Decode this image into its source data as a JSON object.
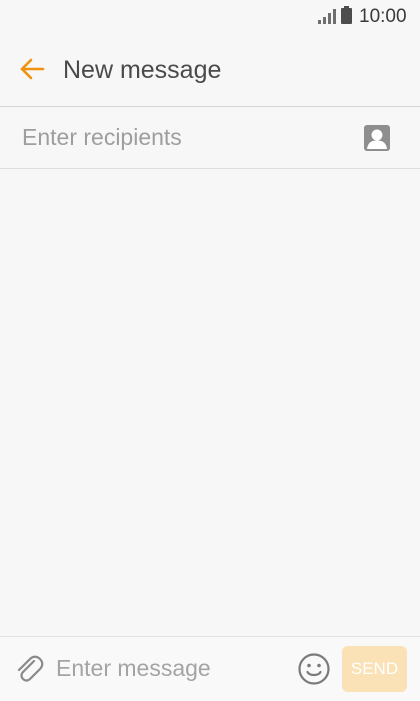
{
  "status_bar": {
    "time": "10:00",
    "signal_icon": "signal-icon",
    "battery_icon": "battery-icon"
  },
  "header": {
    "back_icon": "arrow-left-icon",
    "title": "New message",
    "accent_color": "#f0920f"
  },
  "recipients": {
    "placeholder": "Enter recipients",
    "contacts_icon": "contact-icon"
  },
  "compose": {
    "attach_icon": "paperclip-icon",
    "placeholder": "Enter message",
    "emoji_icon": "emoji-icon",
    "send_label": "SEND",
    "send_color": "#fbe1b6"
  }
}
